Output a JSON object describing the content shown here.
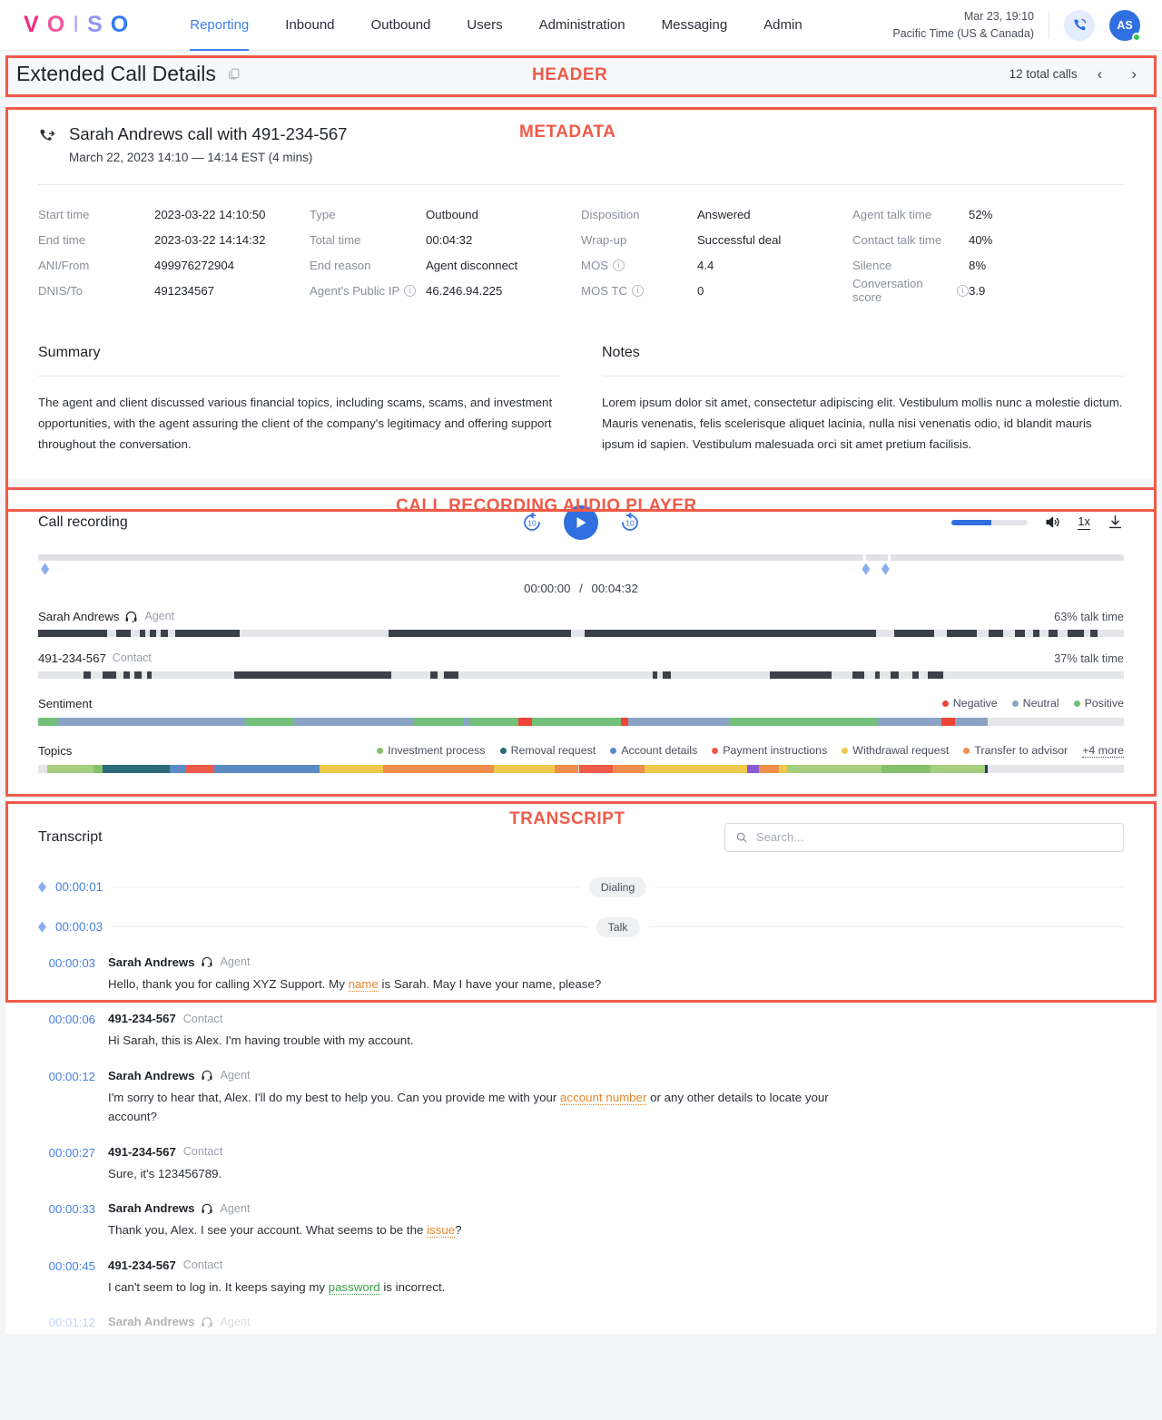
{
  "topnav": {
    "logo_letters": [
      "V",
      "O",
      "I",
      "S",
      "O"
    ],
    "items": [
      {
        "label": "Reporting",
        "active": true
      },
      {
        "label": "Inbound",
        "active": false
      },
      {
        "label": "Outbound",
        "active": false
      },
      {
        "label": "Users",
        "active": false
      },
      {
        "label": "Administration",
        "active": false
      },
      {
        "label": "Messaging",
        "active": false
      },
      {
        "label": "Admin",
        "active": false
      }
    ],
    "clock_date": "Mar 23, 19:10",
    "clock_zone": "Pacific Time (US & Canada)",
    "avatar_initials": "AS"
  },
  "annotations": {
    "header": "HEADER",
    "metadata": "METADATA",
    "player": "CALL RECORDING AUDIO PLAYER",
    "transcript": "TRANSCRIPT",
    "color": "#ef5b49"
  },
  "page_header": {
    "title": "Extended Call Details",
    "copy_icon": "copy-icon",
    "total_calls": "12 total calls",
    "prev": "‹",
    "next": "›"
  },
  "metadata": {
    "call_icon": "outbound-call-icon",
    "call_title": "Sarah Andrews call with 491-234-567",
    "call_subtitle": "March 22, 2023  14:10 — 14:14 EST (4 mins)",
    "columns": [
      [
        {
          "key": "Start time",
          "value": "2023-03-22   14:10:50",
          "info": false
        },
        {
          "key": "End time",
          "value": "2023-03-22   14:14:32",
          "info": false
        },
        {
          "key": "ANI/From",
          "value": "499976272904",
          "info": false
        },
        {
          "key": "DNIS/To",
          "value": "491234567",
          "info": false
        }
      ],
      [
        {
          "key": "Type",
          "value": "Outbound",
          "info": false
        },
        {
          "key": "Total  time",
          "value": "00:04:32",
          "info": false
        },
        {
          "key": "End reason",
          "value": "Agent disconnect",
          "info": false
        },
        {
          "key": "Agent's Public IP",
          "value": "46.246.94.225",
          "info": true
        }
      ],
      [
        {
          "key": "Disposition",
          "value": "Answered",
          "info": false
        },
        {
          "key": "Wrap-up",
          "value": "Successful deal",
          "info": false
        },
        {
          "key": "MOS",
          "value": "4.4",
          "info": true
        },
        {
          "key": "MOS TC",
          "value": "0",
          "info": true
        }
      ],
      [
        {
          "key": "Agent talk time",
          "value": "52%",
          "info": false
        },
        {
          "key": "Contact talk time",
          "value": "40%",
          "info": false
        },
        {
          "key": "Silence",
          "value": "8%",
          "info": false
        },
        {
          "key": "Conversation score",
          "value": "3.9",
          "info": true
        }
      ]
    ],
    "summary_heading": "Summary",
    "summary_text": "The agent and client discussed various financial topics, including scams, scams, and investment opportunities, with the agent assuring the client of the company's legitimacy and offering support throughout the conversation.",
    "notes_heading": "Notes",
    "notes_text": "Lorem ipsum dolor sit amet, consectetur adipiscing elit. Vestibulum mollis nunc a molestie dictum. Mauris venenatis, felis scelerisque aliquet lacinia, nulla nisi venenatis odio, id blandit mauris ipsum id sapien. Vestibulum malesuada orci sit amet pretium facilisis."
  },
  "player": {
    "label": "Call recording",
    "rewind_label": "10",
    "forward_label": "10",
    "play_icon": "play-icon",
    "volume_percent": 52,
    "speaker_icon": "volume-icon",
    "speed": "1x",
    "download_icon": "download-icon",
    "current_time": "00:00:00",
    "total_time": "00:04:32",
    "time_separator": "/",
    "timeline_markers_pct": [
      0.6,
      76.2,
      78.0
    ],
    "agent": {
      "name": "Sarah Andrews",
      "role": "Agent",
      "icon": "headset-icon",
      "talk_time": "63% talk time",
      "segments": [
        [
          0,
          9.2
        ],
        [
          10.3,
          2.0
        ],
        [
          13.5,
          0.7
        ],
        [
          14.8,
          0.8
        ],
        [
          16.3,
          0.9
        ],
        [
          18.2,
          8.5
        ],
        [
          46.5,
          24.2
        ],
        [
          72.5,
          38.6
        ],
        [
          113.5,
          5.3
        ],
        [
          120.5,
          4.0
        ],
        [
          126.0,
          2.0
        ],
        [
          129.5,
          1.4
        ],
        [
          132.0,
          0.8
        ],
        [
          134.0,
          1.2
        ],
        [
          136.5,
          2.2
        ],
        [
          139.5,
          1.0
        ]
      ]
    },
    "contact": {
      "name": "491-234-567",
      "role": "Contact",
      "talk_time": "37% talk time",
      "segments": [
        [
          6.0,
          1.0
        ],
        [
          8.5,
          1.8
        ],
        [
          11.3,
          0.9
        ],
        [
          12.8,
          0.9
        ],
        [
          14.5,
          0.6
        ],
        [
          26.0,
          20.8
        ],
        [
          52.0,
          1.0
        ],
        [
          53.8,
          2.0
        ],
        [
          81.5,
          0.6
        ],
        [
          82.8,
          1.1
        ],
        [
          97.0,
          8.2
        ],
        [
          108.0,
          1.6
        ],
        [
          111.0,
          0.6
        ],
        [
          113.0,
          1.1
        ],
        [
          116.0,
          0.8
        ],
        [
          118.0,
          2.0
        ]
      ]
    },
    "sentiment": {
      "label": "Sentiment",
      "legend": [
        {
          "label": "Negative",
          "color": "#f04438"
        },
        {
          "label": "Neutral",
          "color": "#8aa3c4"
        },
        {
          "label": "Positive",
          "color": "#72c07a"
        }
      ],
      "segments": [
        {
          "x": 0,
          "w": 2.5,
          "color": "#72c07a"
        },
        {
          "x": 2.5,
          "w": 25.0,
          "color": "#8aa3c4"
        },
        {
          "x": 27.5,
          "w": 6.5,
          "color": "#72c07a"
        },
        {
          "x": 34.0,
          "w": 15.8,
          "color": "#8aa3c4"
        },
        {
          "x": 49.8,
          "w": 6.5,
          "color": "#72c07a"
        },
        {
          "x": 56.3,
          "w": 0.9,
          "color": "#8aa3c4"
        },
        {
          "x": 57.2,
          "w": 6.5,
          "color": "#72c07a"
        },
        {
          "x": 63.7,
          "w": 1.8,
          "color": "#f04438"
        },
        {
          "x": 65.5,
          "w": 11.8,
          "color": "#72c07a"
        },
        {
          "x": 77.3,
          "w": 1.0,
          "color": "#f04438"
        },
        {
          "x": 78.3,
          "w": 13.5,
          "color": "#8aa3c4"
        },
        {
          "x": 91.8,
          "w": 19.5,
          "color": "#72c07a"
        },
        {
          "x": 111.3,
          "w": 8.5,
          "color": "#8aa3c4"
        },
        {
          "x": 119.8,
          "w": 1.8,
          "color": "#f04438"
        },
        {
          "x": 121.6,
          "w": 4.4,
          "color": "#8aa3c4"
        }
      ]
    },
    "topics": {
      "label": "Topics",
      "legend": [
        {
          "label": "Investment process",
          "color": "#84c168"
        },
        {
          "label": "Removal request",
          "color": "#2d6b78"
        },
        {
          "label": "Account details",
          "color": "#5a8bc4"
        },
        {
          "label": "Payment instructions",
          "color": "#ef5b49"
        },
        {
          "label": "Withdrawal request",
          "color": "#efc94c"
        },
        {
          "label": "Transfer to advisor",
          "color": "#ef8e4c"
        }
      ],
      "more_label": "+4 more",
      "segments": [
        {
          "x": 0,
          "w": 1.2,
          "color": "#e4e6e9"
        },
        {
          "x": 1.2,
          "w": 6.2,
          "color": "#a5cf7e"
        },
        {
          "x": 7.4,
          "w": 1.2,
          "color": "#84c168"
        },
        {
          "x": 8.6,
          "w": 8.8,
          "color": "#2d6b78"
        },
        {
          "x": 17.4,
          "w": 2.1,
          "color": "#5a8bc4"
        },
        {
          "x": 19.5,
          "w": 3.8,
          "color": "#ef5b49"
        },
        {
          "x": 23.3,
          "w": 14.0,
          "color": "#5a8bc4"
        },
        {
          "x": 37.3,
          "w": 8.4,
          "color": "#efc94c"
        },
        {
          "x": 45.7,
          "w": 14.8,
          "color": "#ef8e4c"
        },
        {
          "x": 60.5,
          "w": 8.0,
          "color": "#efc94c"
        },
        {
          "x": 68.5,
          "w": 3.2,
          "color": "#ef8e4c"
        },
        {
          "x": 71.7,
          "w": 4.5,
          "color": "#ef5b49"
        },
        {
          "x": 76.2,
          "w": 4.2,
          "color": "#ef8e4c"
        },
        {
          "x": 80.4,
          "w": 13.6,
          "color": "#efc94c"
        },
        {
          "x": 94.0,
          "w": 1.6,
          "color": "#8a5ad4"
        },
        {
          "x": 95.6,
          "w": 2.6,
          "color": "#ef8e4c"
        },
        {
          "x": 98.2,
          "w": 1.1,
          "color": "#efc94c"
        },
        {
          "x": 99.3,
          "w": 12.6,
          "color": "#a5cf7e"
        },
        {
          "x": 111.9,
          "w": 6.5,
          "color": "#84c168"
        },
        {
          "x": 118.4,
          "w": 7.2,
          "color": "#a5cf7e"
        },
        {
          "x": 125.6,
          "w": 0.4,
          "color": "#2a3b6b"
        }
      ]
    }
  },
  "transcript": {
    "heading": "Transcript",
    "search_placeholder": "Search...",
    "search_value": "",
    "search_icon": "search-icon",
    "events": [
      {
        "time": "00:00:01",
        "chip": "Dialing"
      },
      {
        "time": "00:00:03",
        "chip": "Talk"
      }
    ],
    "turns": [
      {
        "time": "00:00:03",
        "name": "Sarah Andrews",
        "role": "Agent",
        "is_agent": true,
        "parts": [
          {
            "t": "Hello, thank you for calling XYZ Support. My ",
            "k": null
          },
          {
            "t": "name",
            "k": "orange"
          },
          {
            "t": " is Sarah. May I have your name, please?",
            "k": null
          }
        ]
      },
      {
        "time": "00:00:06",
        "name": "491-234-567",
        "role": "Contact",
        "is_agent": false,
        "parts": [
          {
            "t": "Hi Sarah, this is Alex. I'm having trouble with my account.",
            "k": null
          }
        ]
      },
      {
        "time": "00:00:12",
        "name": "Sarah Andrews",
        "role": "Agent",
        "is_agent": true,
        "parts": [
          {
            "t": "I'm sorry to hear that, Alex. I'll do my best to help you. Can you provide me with your ",
            "k": null
          },
          {
            "t": "account number",
            "k": "orange"
          },
          {
            "t": " or any other details to locate your account?",
            "k": null
          }
        ]
      },
      {
        "time": "00:00:27",
        "name": "491-234-567",
        "role": "Contact",
        "is_agent": false,
        "parts": [
          {
            "t": "Sure, it's 123456789.",
            "k": null
          }
        ]
      },
      {
        "time": "00:00:33",
        "name": "Sarah Andrews",
        "role": "Agent",
        "is_agent": true,
        "parts": [
          {
            "t": "Thank you, Alex. I see your account. What seems to be the ",
            "k": null
          },
          {
            "t": "issue",
            "k": "orange"
          },
          {
            "t": "?",
            "k": null
          }
        ]
      },
      {
        "time": "00:00:45",
        "name": "491-234-567",
        "role": "Contact",
        "is_agent": false,
        "parts": [
          {
            "t": "I can't seem to log in. It keeps saying my ",
            "k": null
          },
          {
            "t": "password",
            "k": "green"
          },
          {
            "t": " is incorrect.",
            "k": null
          }
        ]
      },
      {
        "time": "00:01:12",
        "name": "Sarah Andrews",
        "role": "Agent",
        "is_agent": true,
        "parts": [
          {
            "t": "",
            "k": null
          }
        ]
      }
    ]
  }
}
